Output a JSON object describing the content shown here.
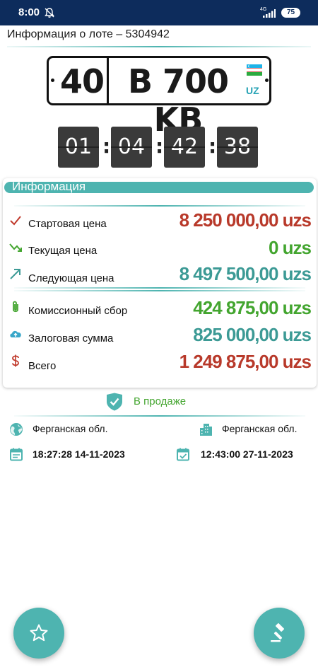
{
  "status_bar": {
    "time": "8:00",
    "network": "4G",
    "battery": "75",
    "bell_icon": "bell-off-icon",
    "signal_icon": "signal-icon"
  },
  "header": {
    "title": "Информация о лоте – 5304942"
  },
  "plate": {
    "region": "40",
    "number": "B 700 KB",
    "country": "UZ",
    "flag_icon": "uzbekistan-flag-icon"
  },
  "timer": {
    "days": "01",
    "hours": "04",
    "minutes": "42",
    "seconds": "38",
    "separator": ":"
  },
  "info": {
    "title": "Информация",
    "rows": [
      {
        "label": "Стартовая цена",
        "value": "8 250 000,00 uzs",
        "color": "#b8392a",
        "icon": "check-icon"
      },
      {
        "label": "Текущая цена",
        "value": "0 uzs",
        "color": "#43a52f",
        "icon": "trend-down-icon"
      },
      {
        "label": "Следующая цена",
        "value": "8 497 500,00 uzs",
        "color": "#3c9a95",
        "icon": "arrow-up-right-icon"
      },
      {
        "label": "Комиссионный сбор",
        "value": "424 875,00 uzs",
        "color": "#43a52f",
        "icon": "paperclip-icon"
      },
      {
        "label": "Залоговая сумма",
        "value": "825 000,00 uzs",
        "color": "#3c9a95",
        "icon": "cloud-upload-icon"
      },
      {
        "label": "Всего",
        "value": "1 249 875,00 uzs",
        "color": "#b8392a",
        "icon": "dollar-icon"
      }
    ]
  },
  "sale_status": {
    "label": "В продаже",
    "icon": "shield-check-icon",
    "color": "#43a52f"
  },
  "meta": {
    "region_left": "Ферганская обл.",
    "region_right": "Ферганская обл.",
    "date_left": "18:27:28 14-11-2023",
    "date_right": "12:43:00 27-11-2023",
    "globe_icon": "globe-icon",
    "city_icon": "city-icon",
    "calendar_icon": "calendar-icon",
    "calendar_check_icon": "calendar-check-icon"
  },
  "fabs": {
    "favorite_icon": "star-icon",
    "bid_icon": "gavel-icon"
  },
  "colors": {
    "accent": "#4eb4b0",
    "status_bar": "#0d2c5c",
    "timer_box": "#3a3a3a"
  }
}
